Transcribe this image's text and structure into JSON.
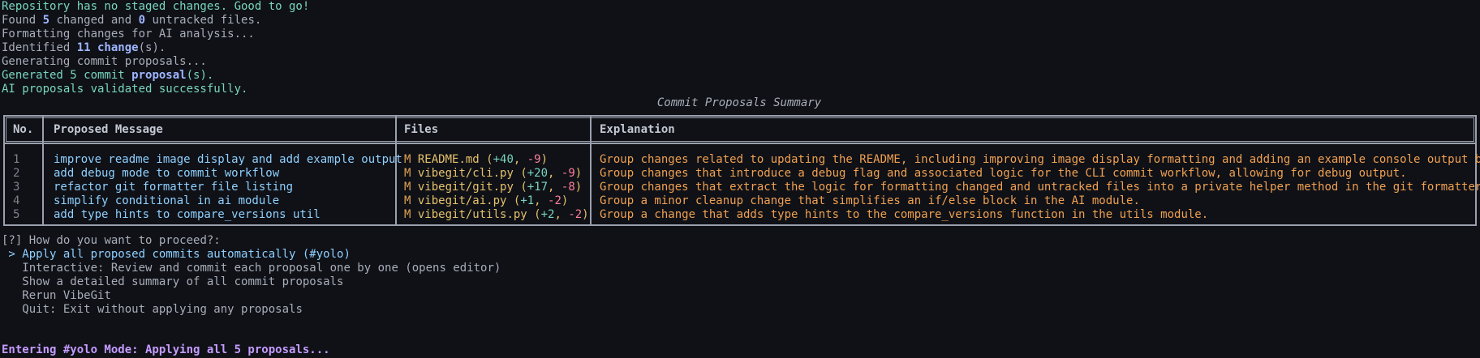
{
  "log": {
    "line1": "Repository has no staged changes. Good to go!",
    "line2_prefix": "Found ",
    "line2_changed": "5",
    "line2_mid": " changed and ",
    "line2_untracked": "0",
    "line2_suffix": " untracked files.",
    "line3": "Formatting changes for AI analysis...",
    "line4_prefix": "Identified ",
    "line4_count": "11",
    "line4_word": " change",
    "line4_suffix": "(s).",
    "line5": "Generating commit proposals...",
    "line6_prefix": "Generated 5 commit ",
    "line6_word": "proposal",
    "line6_suffix": "(s).",
    "line7": "AI proposals validated successfully."
  },
  "table": {
    "caption": "Commit Proposals Summary",
    "headers": {
      "no": "No.",
      "message": "Proposed Message",
      "files": "Files",
      "explanation": "Explanation"
    },
    "rows": [
      {
        "no": "1",
        "message": "improve readme image display and add example output",
        "file_status": "M",
        "file_name": "README.md",
        "plus": "+40",
        "minus": "-9",
        "explanation": "Group changes related to updating the README, including improving image display formatting and adding an example console output block."
      },
      {
        "no": "2",
        "message": "add debug mode to commit workflow",
        "file_status": "M",
        "file_name": "vibegit/cli.py",
        "plus": "+20",
        "minus": "-9",
        "explanation": "Group changes that introduce a debug flag and associated logic for the CLI commit workflow, allowing for debug output."
      },
      {
        "no": "3",
        "message": "refactor git formatter file listing",
        "file_status": "M",
        "file_name": "vibegit/git.py",
        "plus": "+17",
        "minus": "-8",
        "explanation": "Group changes that extract the logic for formatting changed and untracked files into a private helper method in the git formatter."
      },
      {
        "no": "4",
        "message": "simplify conditional in ai module",
        "file_status": "M",
        "file_name": "vibegit/ai.py",
        "plus": "+1",
        "minus": "-2",
        "explanation": "Group a minor cleanup change that simplifies an if/else block in the AI module."
      },
      {
        "no": "5",
        "message": "add type hints to compare_versions util",
        "file_status": "M",
        "file_name": "vibegit/utils.py",
        "plus": "+2",
        "minus": "-2",
        "explanation": "Group a change that adds type hints to the compare_versions function in the utils module."
      }
    ]
  },
  "prompt": {
    "question_mark": "[?]",
    "question": " How do you want to proceed?:",
    "options": [
      {
        "marker": " > ",
        "label": "Apply all proposed commits automatically (#yolo)"
      },
      {
        "marker": "   ",
        "label": "Interactive: Review and commit each proposal one by one (opens editor)"
      },
      {
        "marker": "   ",
        "label": "Show a detailed summary of all commit proposals"
      },
      {
        "marker": "   ",
        "label": "Rerun VibeGit"
      },
      {
        "marker": "   ",
        "label": "Quit: Exit without applying any proposals"
      }
    ]
  },
  "footer": {
    "message": "Entering #yolo Mode: Applying all 5 proposals..."
  },
  "colors": {
    "background": "#0f1117",
    "success": "#79d6bf",
    "info": "#a8adb8",
    "accent": "#8fd0ff",
    "highlight": "#c59bff",
    "file": "#e6c16a",
    "explanation": "#f0a050"
  }
}
